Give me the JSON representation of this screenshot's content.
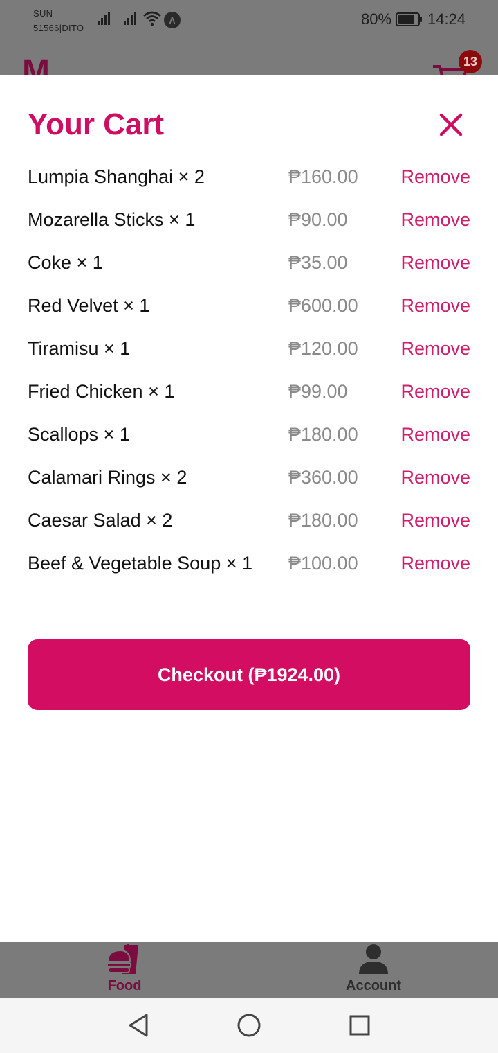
{
  "status_bar": {
    "carrier_line1": "SUN",
    "carrier_line2": "51566|DITO",
    "app_badge": "Λ",
    "battery_percent": "80%",
    "time": "14:24"
  },
  "header": {
    "cart_count": "13"
  },
  "cart": {
    "title": "Your Cart",
    "close_icon": "close-x-icon",
    "remove_label": "Remove",
    "items": [
      {
        "name": "Lumpia Shanghai × 2",
        "price": "₱160.00"
      },
      {
        "name": "Mozarella Sticks × 1",
        "price": "₱90.00"
      },
      {
        "name": "Coke × 1",
        "price": "₱35.00"
      },
      {
        "name": "Red Velvet × 1",
        "price": "₱600.00"
      },
      {
        "name": "Tiramisu × 1",
        "price": "₱120.00"
      },
      {
        "name": "Fried Chicken × 1",
        "price": "₱99.00"
      },
      {
        "name": "Scallops × 1",
        "price": "₱180.00"
      },
      {
        "name": "Calamari Rings × 2",
        "price": "₱360.00"
      },
      {
        "name": "Caesar Salad × 2",
        "price": "₱180.00"
      },
      {
        "name": "Beef & Vegetable Soup × 1",
        "price": "₱100.00"
      }
    ],
    "checkout_label": "Checkout (₱1924.00)"
  },
  "tabs": [
    {
      "label": "Food",
      "icon": "food-icon",
      "active": true
    },
    {
      "label": "Account",
      "icon": "account-icon",
      "active": false
    }
  ],
  "colors": {
    "accent": "#d30d62",
    "overlay": "#7b7b7b",
    "price_text": "#8a8a8a"
  }
}
